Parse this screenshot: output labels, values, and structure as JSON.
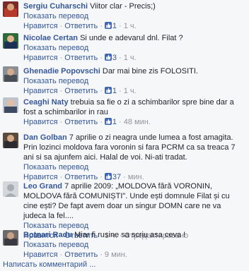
{
  "comments": [
    {
      "author": "Sergiu Cuharschi",
      "text": "Viitor clar - Precis;)",
      "translate": "Показать перевод",
      "like": "Нравится",
      "reply": "Ответить",
      "likes": "1",
      "time": "1 ч.",
      "edited": ""
    },
    {
      "author": "Nicolae Certan",
      "text": "Si unde e adevarul dnl. Filat ?",
      "translate": "Показать перевод",
      "like": "Нравится",
      "reply": "Ответить",
      "likes": "3",
      "time": "1 ч.",
      "edited": ""
    },
    {
      "author": "Ghenadie Popovschi",
      "text": "Dar mai bine zis FOLOSITI.",
      "translate": "Показать перевод",
      "like": "Нравится",
      "reply": "Ответить",
      "likes": "1",
      "time": "1 ч.",
      "edited": ""
    },
    {
      "author": "Ceaghi Naty",
      "text": "trebuia sa fie o zi a schimbarilor spre bine dar a fost a schimbarilor in rau",
      "translate": "",
      "like": "Нравится",
      "reply": "Ответить",
      "likes": "1",
      "time": "48 мин.",
      "edited": ""
    },
    {
      "author": "Dan Golban",
      "text": "7 aprilie o zi neagra unde lumea a fost amagita. Prin lozinci moldova fara voronin si fara PCRM ca sa treaca 7 ani si sa ajunfem aici. Halal de voi. Ni-ati tradat.",
      "translate": "Показать перевод",
      "like": "Нравится",
      "reply": "Ответить",
      "likes": "37",
      "time": "мин.",
      "edited": ""
    },
    {
      "author": "Leo Grand",
      "text": "7 aprilie 2009: „MOLDOVA fără VORONIN, MOLDOVA fără COMUNIȘTI\". Unde ești domnule Filat și cu cine ești? De fapt avem doar un singur DOMN care ne va judeca la fel....",
      "translate": "Показать перевод",
      "like": "Нравится",
      "reply": "Ответить",
      "likes": "",
      "time": "1 ч.",
      "edited": "Отредактировано"
    },
    {
      "author": "Botnari Radu",
      "text": "Miar fi rusine sa scriu asa ceva !",
      "translate": "Показать перевод",
      "like": "Нравится",
      "reply": "Ответить",
      "likes": "",
      "time": "9 мин.",
      "edited": ""
    }
  ],
  "write_comment": "Написать комментарий ...",
  "colors": {
    "link": "#365899",
    "meta": "#90949c",
    "like_badge": "#4267b2",
    "background": "#f6f7f9"
  }
}
